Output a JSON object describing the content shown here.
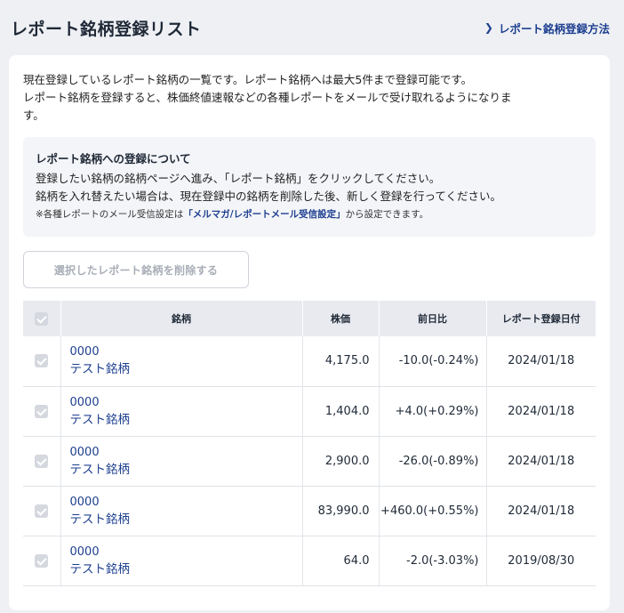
{
  "header": {
    "title": "レポート銘柄登録リスト",
    "help_link": "レポート銘柄登録方法"
  },
  "intro": {
    "line1": "現在登録しているレポート銘柄の一覧です。レポート銘柄へは最大5件まで登録可能です。",
    "line2": "レポート銘柄を登録すると、株価終値速報などの各種レポートをメールで受け取れるようになりま",
    "line3": "す。"
  },
  "notice": {
    "title": "レポート銘柄への登録について",
    "line1": "登録したい銘柄の銘柄ページへ進み、「レポート銘柄」をクリックしてください。",
    "line2": "銘柄を入れ替えたい場合は、現在登録中の銘柄を削除した後、新しく登録を行ってください。",
    "note_prefix": "※各種レポートのメール受信設定は",
    "note_link": "「メルマガ/レポートメール受信設定」",
    "note_suffix": "から設定できます。"
  },
  "delete_button": {
    "label": "選択したレポート銘柄を削除する",
    "disabled": true
  },
  "table": {
    "columns": [
      "銘柄",
      "株価",
      "前日比",
      "レポート登録日付"
    ],
    "rows": [
      {
        "code": "0000",
        "name": "テスト銘柄",
        "price": "4,175.0",
        "change": "-10.0(-0.24%)",
        "direction": "down",
        "date": "2024/01/18"
      },
      {
        "code": "0000",
        "name": "テスト銘柄",
        "price": "1,404.0",
        "change": "+4.0(+0.29%)",
        "direction": "up",
        "date": "2024/01/18"
      },
      {
        "code": "0000",
        "name": "テスト銘柄",
        "price": "2,900.0",
        "change": "-26.0(-0.89%)",
        "direction": "down",
        "date": "2024/01/18"
      },
      {
        "code": "0000",
        "name": "テスト銘柄",
        "price": "83,990.0",
        "change": "+460.0(+0.55%)",
        "direction": "up",
        "date": "2024/01/18"
      },
      {
        "code": "0000",
        "name": "テスト銘柄",
        "price": "64.0",
        "change": "-2.0(-3.03%)",
        "direction": "down",
        "date": "2019/08/30"
      }
    ]
  },
  "colors": {
    "link": "#1d3f8f",
    "negative": "#1a6fb5",
    "positive": "#d0242b",
    "background": "#eef0f4"
  },
  "icons": {
    "help_link": "chevron-right-icon",
    "checkbox": "checkbox-icon"
  }
}
